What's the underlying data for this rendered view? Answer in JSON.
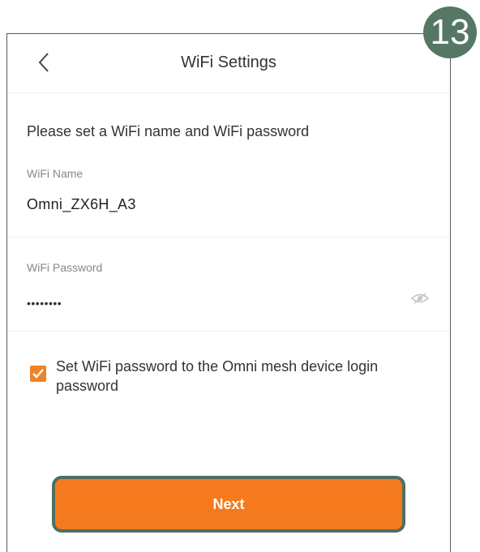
{
  "header": {
    "title": "WiFi Settings"
  },
  "prompt": "Please set a WiFi name and WiFi password",
  "wifi_name": {
    "label": "WiFi Name",
    "value": "Omni_ZX6H_A3"
  },
  "wifi_password": {
    "label": "WiFi Password",
    "masked_value": "••••••••"
  },
  "checkbox": {
    "checked": true,
    "label": "Set WiFi password to the Omni mesh device login password"
  },
  "next_button": {
    "label": "Next"
  },
  "step_badge": "13",
  "icons": [
    "back-chevron-icon",
    "eye-hidden-icon",
    "checkmark-icon"
  ],
  "colors": {
    "accent_orange": "#f57a1e",
    "badge_green": "#557766",
    "highlight_border": "#4f6f5f"
  }
}
